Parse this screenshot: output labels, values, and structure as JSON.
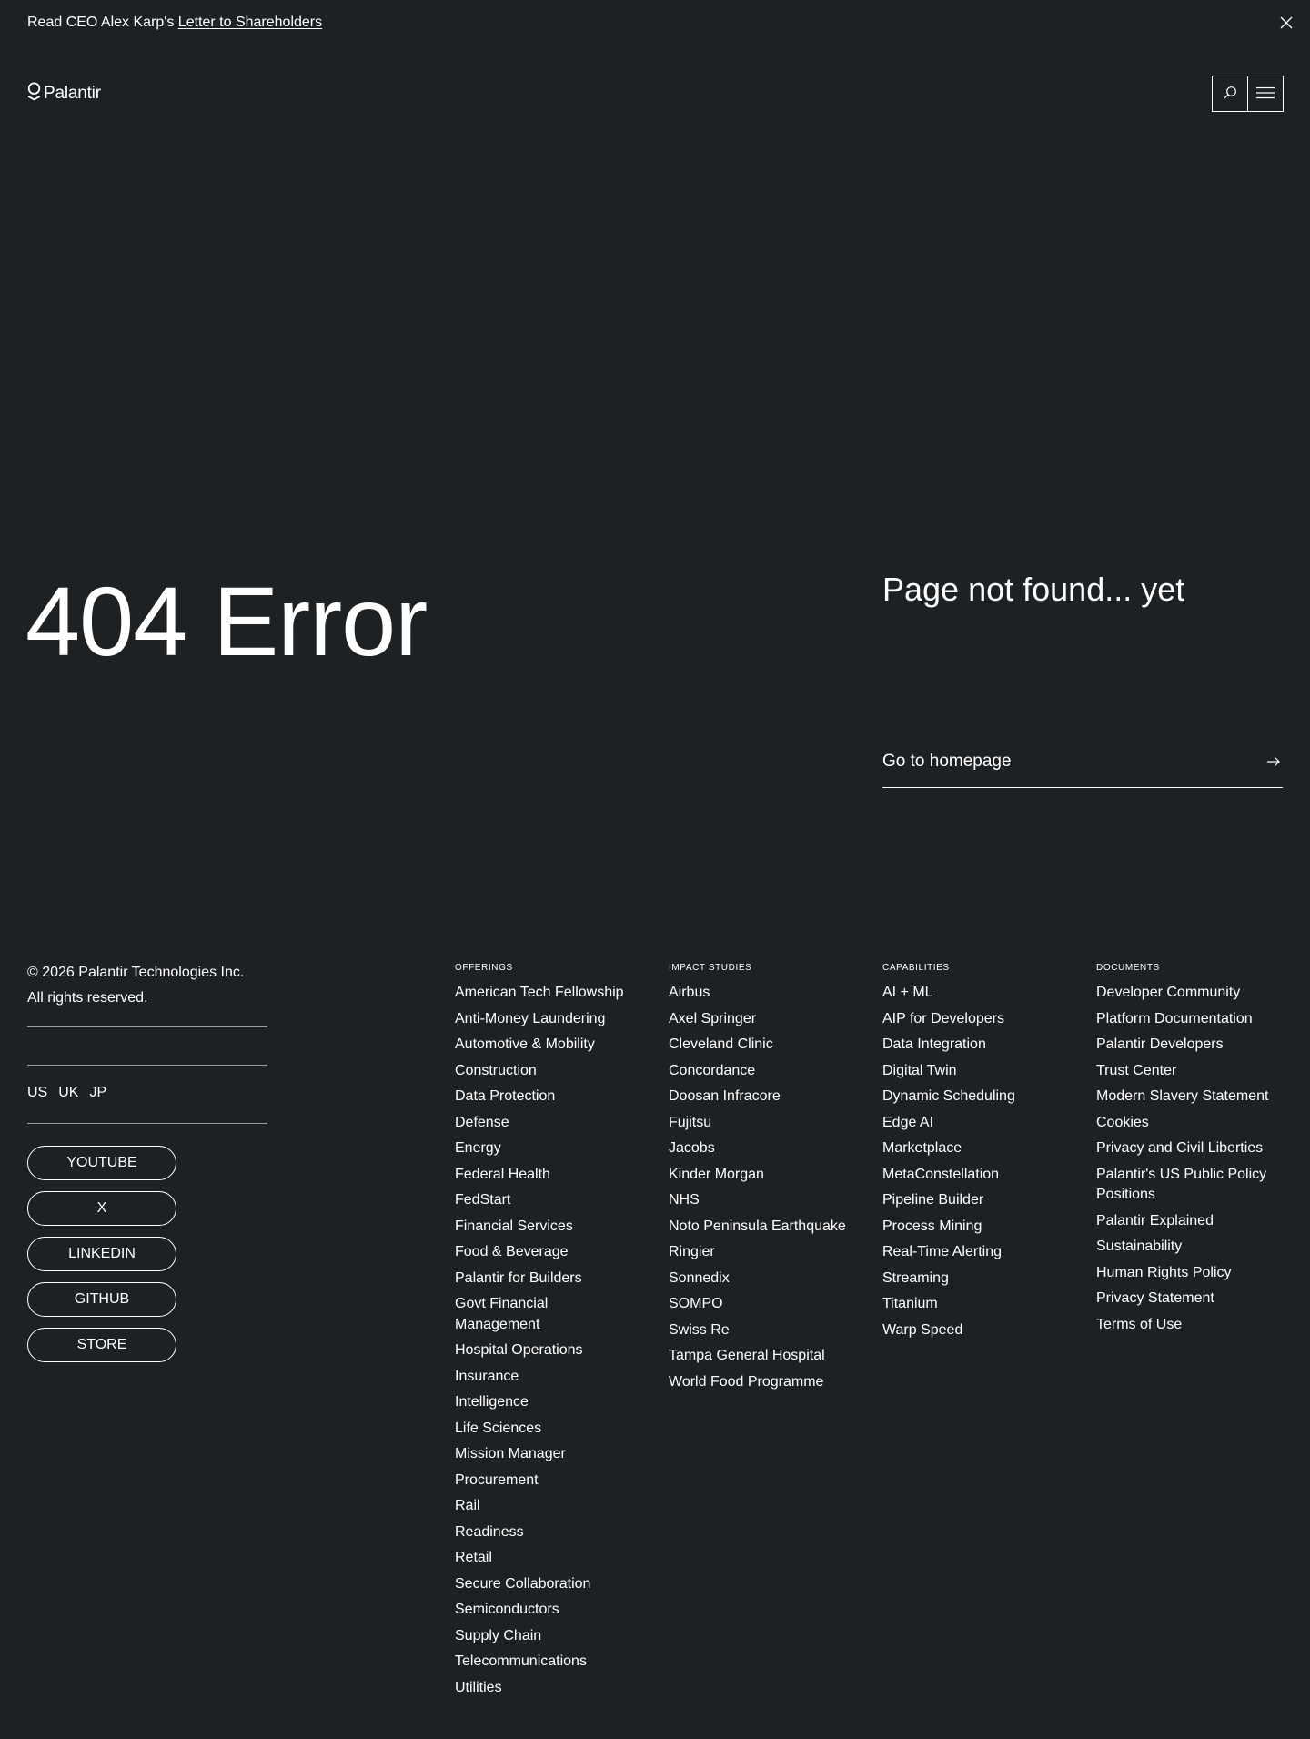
{
  "announcement": {
    "prefix": "Read CEO Alex Karp's ",
    "link_text": "Letter to Shareholders"
  },
  "header": {
    "logo_text": "Palantir",
    "search_icon": "search-icon",
    "menu_icon": "hamburger-menu-icon"
  },
  "hero": {
    "title": "404 Error",
    "subtitle": "Page not found... yet",
    "cta_label": "Go to homepage"
  },
  "footer": {
    "copyright_line1": "© 2026 Palantir Technologies Inc.",
    "copyright_line2": "All rights reserved.",
    "locales": [
      "US",
      "UK",
      "JP"
    ],
    "socials": [
      "YOUTUBE",
      "X",
      "LINKEDIN",
      "GITHUB",
      "STORE"
    ],
    "columns": {
      "offerings": {
        "title": "OFFERINGS",
        "items": [
          "American Tech Fellowship",
          "Anti-Money Laundering",
          "Automotive & Mobility",
          "Construction",
          "Data Protection",
          "Defense",
          "Energy",
          "Federal Health",
          "FedStart",
          "Financial Services",
          "Food & Beverage",
          "Palantir for Builders",
          "Govt Financial Management",
          "Hospital Operations",
          "Insurance",
          "Intelligence",
          "Life Sciences",
          "Mission Manager",
          "Procurement",
          "Rail",
          "Readiness",
          "Retail",
          "Secure Collaboration",
          "Semiconductors",
          "Supply Chain",
          "Telecommunications",
          "Utilities"
        ]
      },
      "impact_studies": {
        "title": "IMPACT STUDIES",
        "items": [
          "Airbus",
          "Axel Springer",
          "Cleveland Clinic",
          "Concordance",
          "Doosan Infracore",
          "Fujitsu",
          "Jacobs",
          "Kinder Morgan",
          "NHS",
          "Noto Peninsula Earthquake",
          "Ringier",
          "Sonnedix",
          "SOMPO",
          "Swiss Re",
          "Tampa General Hospital",
          "World Food Programme"
        ]
      },
      "capabilities": {
        "title": "CAPABILITIES",
        "items": [
          "AI + ML",
          "AIP for Developers",
          "Data Integration",
          "Digital Twin",
          "Dynamic Scheduling",
          "Edge AI",
          "Marketplace",
          "MetaConstellation",
          "Pipeline Builder",
          "Process Mining",
          "Real-Time Alerting",
          "Streaming",
          "Titanium",
          "Warp Speed"
        ]
      },
      "documents": {
        "title": "DOCUMENTS",
        "items": [
          "Developer Community",
          "Platform Documentation",
          "Palantir Developers",
          "Trust Center",
          "Modern Slavery Statement",
          "Cookies",
          "Privacy and Civil Liberties",
          "Palantir's US Public Policy Positions",
          "Palantir Explained",
          "Sustainability",
          "Human Rights Policy",
          "Privacy Statement",
          "Terms of Use"
        ]
      }
    }
  }
}
